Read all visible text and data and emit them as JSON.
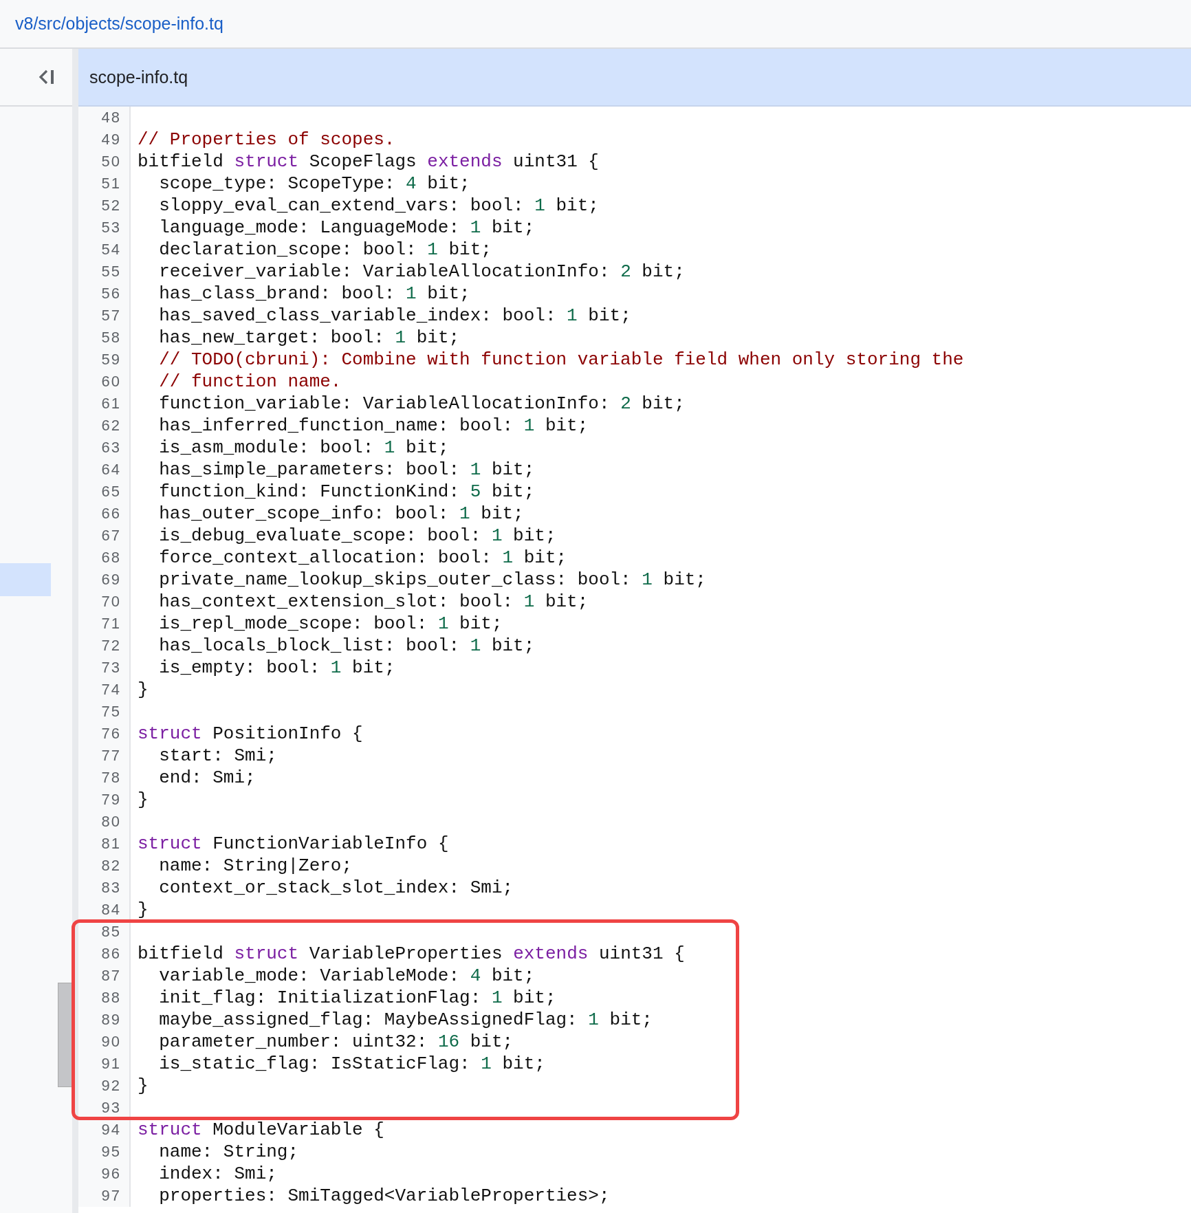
{
  "breadcrumb": {
    "path": "v8/src/objects/scope-info.tq"
  },
  "file_tab": {
    "title": "scope-info.tq"
  },
  "code_sections": [
    {
      "boxed": false,
      "lines": [
        {
          "number": "48"
        },
        {
          "number": "49",
          "tokens": [
            {
              "kind": "comment",
              "text": "// Properties of scopes."
            }
          ]
        },
        {
          "number": "50",
          "tokens": [
            {
              "kind": "plain",
              "text": "bitfield "
            },
            {
              "kind": "keyword",
              "text": "struct"
            },
            {
              "kind": "plain",
              "text": " ScopeFlags "
            },
            {
              "kind": "keyword",
              "text": "extends"
            },
            {
              "kind": "plain",
              "text": " uint31 {"
            }
          ]
        },
        {
          "number": "51",
          "tokens": [
            {
              "kind": "plain",
              "text": "  scope_type: ScopeType: "
            },
            {
              "kind": "number",
              "text": "4"
            },
            {
              "kind": "plain",
              "text": " bit;"
            }
          ]
        },
        {
          "number": "52",
          "tokens": [
            {
              "kind": "plain",
              "text": "  sloppy_eval_can_extend_vars: bool: "
            },
            {
              "kind": "number",
              "text": "1"
            },
            {
              "kind": "plain",
              "text": " bit;"
            }
          ]
        },
        {
          "number": "53",
          "tokens": [
            {
              "kind": "plain",
              "text": "  language_mode: LanguageMode: "
            },
            {
              "kind": "number",
              "text": "1"
            },
            {
              "kind": "plain",
              "text": " bit;"
            }
          ]
        },
        {
          "number": "54",
          "tokens": [
            {
              "kind": "plain",
              "text": "  declaration_scope: bool: "
            },
            {
              "kind": "number",
              "text": "1"
            },
            {
              "kind": "plain",
              "text": " bit;"
            }
          ]
        },
        {
          "number": "55",
          "tokens": [
            {
              "kind": "plain",
              "text": "  receiver_variable: VariableAllocationInfo: "
            },
            {
              "kind": "number",
              "text": "2"
            },
            {
              "kind": "plain",
              "text": " bit;"
            }
          ]
        },
        {
          "number": "56",
          "tokens": [
            {
              "kind": "plain",
              "text": "  has_class_brand: bool: "
            },
            {
              "kind": "number",
              "text": "1"
            },
            {
              "kind": "plain",
              "text": " bit;"
            }
          ]
        },
        {
          "number": "57",
          "tokens": [
            {
              "kind": "plain",
              "text": "  has_saved_class_variable_index: bool: "
            },
            {
              "kind": "number",
              "text": "1"
            },
            {
              "kind": "plain",
              "text": " bit;"
            }
          ]
        },
        {
          "number": "58",
          "tokens": [
            {
              "kind": "plain",
              "text": "  has_new_target: bool: "
            },
            {
              "kind": "number",
              "text": "1"
            },
            {
              "kind": "plain",
              "text": " bit;"
            }
          ]
        },
        {
          "number": "59",
          "tokens": [
            {
              "kind": "comment",
              "text": "  // TODO(cbruni): Combine with function variable field when only storing the"
            }
          ]
        },
        {
          "number": "60",
          "tokens": [
            {
              "kind": "comment",
              "text": "  // function name."
            }
          ]
        },
        {
          "number": "61",
          "tokens": [
            {
              "kind": "plain",
              "text": "  function_variable: VariableAllocationInfo: "
            },
            {
              "kind": "number",
              "text": "2"
            },
            {
              "kind": "plain",
              "text": " bit;"
            }
          ]
        },
        {
          "number": "62",
          "tokens": [
            {
              "kind": "plain",
              "text": "  has_inferred_function_name: bool: "
            },
            {
              "kind": "number",
              "text": "1"
            },
            {
              "kind": "plain",
              "text": " bit;"
            }
          ]
        },
        {
          "number": "63",
          "tokens": [
            {
              "kind": "plain",
              "text": "  is_asm_module: bool: "
            },
            {
              "kind": "number",
              "text": "1"
            },
            {
              "kind": "plain",
              "text": " bit;"
            }
          ]
        },
        {
          "number": "64",
          "tokens": [
            {
              "kind": "plain",
              "text": "  has_simple_parameters: bool: "
            },
            {
              "kind": "number",
              "text": "1"
            },
            {
              "kind": "plain",
              "text": " bit;"
            }
          ]
        },
        {
          "number": "65",
          "tokens": [
            {
              "kind": "plain",
              "text": "  function_kind: FunctionKind: "
            },
            {
              "kind": "number",
              "text": "5"
            },
            {
              "kind": "plain",
              "text": " bit;"
            }
          ]
        },
        {
          "number": "66",
          "tokens": [
            {
              "kind": "plain",
              "text": "  has_outer_scope_info: bool: "
            },
            {
              "kind": "number",
              "text": "1"
            },
            {
              "kind": "plain",
              "text": " bit;"
            }
          ]
        },
        {
          "number": "67",
          "tokens": [
            {
              "kind": "plain",
              "text": "  is_debug_evaluate_scope: bool: "
            },
            {
              "kind": "number",
              "text": "1"
            },
            {
              "kind": "plain",
              "text": " bit;"
            }
          ]
        },
        {
          "number": "68",
          "tokens": [
            {
              "kind": "plain",
              "text": "  force_context_allocation: bool: "
            },
            {
              "kind": "number",
              "text": "1"
            },
            {
              "kind": "plain",
              "text": " bit;"
            }
          ]
        },
        {
          "number": "69",
          "tokens": [
            {
              "kind": "plain",
              "text": "  private_name_lookup_skips_outer_class: bool: "
            },
            {
              "kind": "number",
              "text": "1"
            },
            {
              "kind": "plain",
              "text": " bit;"
            }
          ]
        },
        {
          "number": "70",
          "tokens": [
            {
              "kind": "plain",
              "text": "  has_context_extension_slot: bool: "
            },
            {
              "kind": "number",
              "text": "1"
            },
            {
              "kind": "plain",
              "text": " bit;"
            }
          ]
        },
        {
          "number": "71",
          "tokens": [
            {
              "kind": "plain",
              "text": "  is_repl_mode_scope: bool: "
            },
            {
              "kind": "number",
              "text": "1"
            },
            {
              "kind": "plain",
              "text": " bit;"
            }
          ]
        },
        {
          "number": "72",
          "tokens": [
            {
              "kind": "plain",
              "text": "  has_locals_block_list: bool: "
            },
            {
              "kind": "number",
              "text": "1"
            },
            {
              "kind": "plain",
              "text": " bit;"
            }
          ]
        },
        {
          "number": "73",
          "tokens": [
            {
              "kind": "plain",
              "text": "  is_empty: bool: "
            },
            {
              "kind": "number",
              "text": "1"
            },
            {
              "kind": "plain",
              "text": " bit;"
            }
          ]
        },
        {
          "number": "74",
          "tokens": [
            {
              "kind": "plain",
              "text": "}"
            }
          ]
        },
        {
          "number": "75"
        },
        {
          "number": "76",
          "tokens": [
            {
              "kind": "keyword",
              "text": "struct"
            },
            {
              "kind": "plain",
              "text": " PositionInfo {"
            }
          ]
        },
        {
          "number": "77",
          "tokens": [
            {
              "kind": "plain",
              "text": "  start: Smi;"
            }
          ]
        },
        {
          "number": "78",
          "tokens": [
            {
              "kind": "plain",
              "text": "  end: Smi;"
            }
          ]
        },
        {
          "number": "79",
          "tokens": [
            {
              "kind": "plain",
              "text": "}"
            }
          ]
        },
        {
          "number": "80"
        },
        {
          "number": "81",
          "tokens": [
            {
              "kind": "keyword",
              "text": "struct"
            },
            {
              "kind": "plain",
              "text": " FunctionVariableInfo {"
            }
          ]
        },
        {
          "number": "82",
          "tokens": [
            {
              "kind": "plain",
              "text": "  name: String|Zero;"
            }
          ]
        },
        {
          "number": "83",
          "tokens": [
            {
              "kind": "plain",
              "text": "  context_or_stack_slot_index: Smi;"
            }
          ]
        },
        {
          "number": "84",
          "tokens": [
            {
              "kind": "plain",
              "text": "}"
            }
          ]
        }
      ]
    },
    {
      "boxed": true,
      "lines": [
        {
          "number": "85"
        },
        {
          "number": "86",
          "tokens": [
            {
              "kind": "plain",
              "text": "bitfield "
            },
            {
              "kind": "keyword",
              "text": "struct"
            },
            {
              "kind": "plain",
              "text": " VariableProperties "
            },
            {
              "kind": "keyword",
              "text": "extends"
            },
            {
              "kind": "plain",
              "text": " uint31 {"
            }
          ]
        },
        {
          "number": "87",
          "tokens": [
            {
              "kind": "plain",
              "text": "  variable_mode: VariableMode: "
            },
            {
              "kind": "number",
              "text": "4"
            },
            {
              "kind": "plain",
              "text": " bit;"
            }
          ]
        },
        {
          "number": "88",
          "tokens": [
            {
              "kind": "plain",
              "text": "  init_flag: InitializationFlag: "
            },
            {
              "kind": "number",
              "text": "1"
            },
            {
              "kind": "plain",
              "text": " bit;"
            }
          ]
        },
        {
          "number": "89",
          "tokens": [
            {
              "kind": "plain",
              "text": "  maybe_assigned_flag: MaybeAssignedFlag: "
            },
            {
              "kind": "number",
              "text": "1"
            },
            {
              "kind": "plain",
              "text": " bit;"
            }
          ]
        },
        {
          "number": "90",
          "tokens": [
            {
              "kind": "plain",
              "text": "  parameter_number: uint32: "
            },
            {
              "kind": "number",
              "text": "16"
            },
            {
              "kind": "plain",
              "text": " bit;"
            }
          ]
        },
        {
          "number": "91",
          "tokens": [
            {
              "kind": "plain",
              "text": "  is_static_flag: IsStaticFlag: "
            },
            {
              "kind": "number",
              "text": "1"
            },
            {
              "kind": "plain",
              "text": " bit;"
            }
          ]
        },
        {
          "number": "92",
          "tokens": [
            {
              "kind": "plain",
              "text": "}"
            }
          ]
        },
        {
          "number": "93"
        }
      ]
    },
    {
      "boxed": false,
      "lines": [
        {
          "number": "94",
          "tokens": [
            {
              "kind": "keyword",
              "text": "struct"
            },
            {
              "kind": "plain",
              "text": " ModuleVariable {"
            }
          ]
        },
        {
          "number": "95",
          "tokens": [
            {
              "kind": "plain",
              "text": "  name: String;"
            }
          ]
        },
        {
          "number": "96",
          "tokens": [
            {
              "kind": "plain",
              "text": "  index: Smi;"
            }
          ]
        },
        {
          "number": "97",
          "tokens": [
            {
              "kind": "plain",
              "text": "  properties: SmiTagged<VariableProperties>;"
            }
          ]
        }
      ]
    }
  ]
}
